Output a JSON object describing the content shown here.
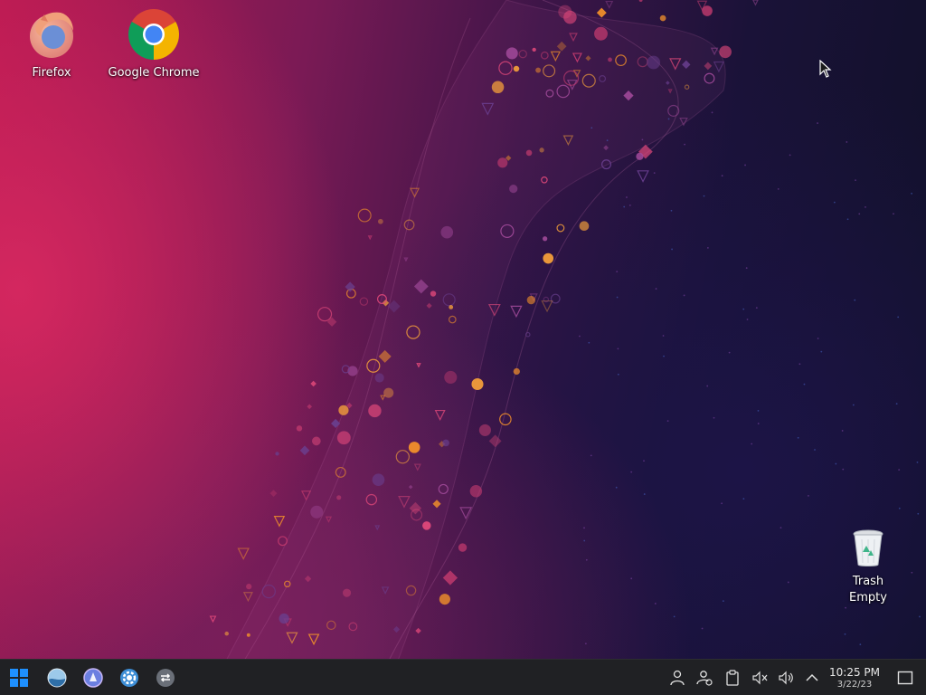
{
  "desktop": {
    "icons": [
      {
        "label": "Firefox"
      },
      {
        "label": "Google Chrome"
      },
      {
        "label": "Trash\nEmpty"
      }
    ]
  },
  "taskbar": {
    "launchers": [
      {
        "icon": "start-menu-icon"
      },
      {
        "icon": "file-manager-icon"
      },
      {
        "icon": "discover-icon"
      },
      {
        "icon": "system-settings-icon"
      },
      {
        "icon": "task-switcher-icon"
      }
    ],
    "tray": [
      {
        "icon": "user-icon"
      },
      {
        "icon": "user-switch-icon"
      },
      {
        "icon": "clipboard-icon"
      },
      {
        "icon": "mic-muted-icon"
      },
      {
        "icon": "volume-icon"
      },
      {
        "icon": "chevron-up-icon"
      }
    ],
    "clock": {
      "time": "10:25 PM",
      "date": "3/22/23"
    }
  },
  "colors": {
    "taskbar_bg": "#202124",
    "start_blue": "#1e90ff",
    "wallpaper_pink": "#b5174f",
    "wallpaper_navy": "#0f1026"
  }
}
